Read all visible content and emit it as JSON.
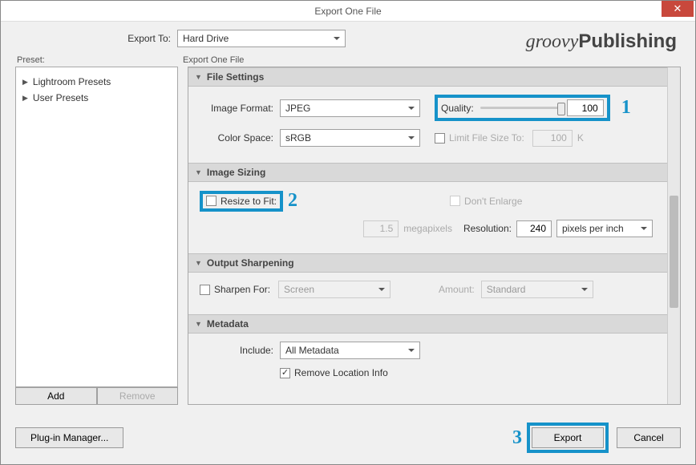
{
  "window": {
    "title": "Export One File"
  },
  "brand": {
    "light": "groovy",
    "bold": "Publishing"
  },
  "exportTo": {
    "label": "Export To:",
    "value": "Hard Drive"
  },
  "preset": {
    "label": "Preset:",
    "items": [
      "Lightroom Presets",
      "User Presets"
    ],
    "add": "Add",
    "remove": "Remove"
  },
  "panelLabel": "Export One File",
  "sections": {
    "fileSettings": {
      "title": "File Settings",
      "imageFormat": {
        "label": "Image Format:",
        "value": "JPEG"
      },
      "quality": {
        "label": "Quality:",
        "value": "100"
      },
      "colorSpace": {
        "label": "Color Space:",
        "value": "sRGB"
      },
      "limitSize": {
        "label": "Limit File Size To:",
        "value": "100",
        "unit": "K"
      }
    },
    "imageSizing": {
      "title": "Image Sizing",
      "resizeToFit": "Resize to Fit:",
      "dontEnlarge": "Don't Enlarge",
      "mpValue": "1.5",
      "mpUnit": "megapixels",
      "resolution": {
        "label": "Resolution:",
        "value": "240",
        "unit": "pixels per inch"
      }
    },
    "outputSharpening": {
      "title": "Output Sharpening",
      "sharpenFor": {
        "label": "Sharpen For:",
        "value": "Screen"
      },
      "amount": {
        "label": "Amount:",
        "value": "Standard"
      }
    },
    "metadata": {
      "title": "Metadata",
      "include": {
        "label": "Include:",
        "value": "All Metadata"
      },
      "removeLocation": "Remove Location Info"
    }
  },
  "callouts": {
    "c1": "1",
    "c2": "2",
    "c3": "3"
  },
  "buttons": {
    "pluginManager": "Plug-in Manager...",
    "export": "Export",
    "cancel": "Cancel"
  }
}
